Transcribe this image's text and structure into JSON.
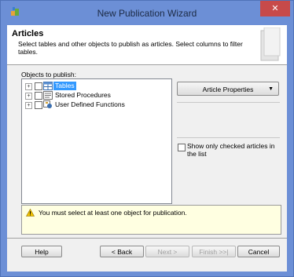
{
  "window": {
    "title": "New Publication Wizard",
    "close_glyph": "✕"
  },
  "header": {
    "title": "Articles",
    "description": "Select tables and other objects to publish as articles. Select columns to filter tables."
  },
  "objects": {
    "label": "Objects to publish:",
    "items": [
      {
        "label": "Tables",
        "selected": true,
        "icon": "table-icon"
      },
      {
        "label": "Stored Procedures",
        "selected": false,
        "icon": "stored-procedure-icon"
      },
      {
        "label": "User Defined Functions",
        "selected": false,
        "icon": "function-icon"
      }
    ],
    "expand_glyph": "+"
  },
  "article_properties": {
    "label": "Article Properties",
    "arrow": "▼"
  },
  "show_only_checked": {
    "label": "Show only checked articles in the list",
    "checked": false
  },
  "message": {
    "icon": "warning-icon",
    "text": "You must select at least one object for publication."
  },
  "buttons": {
    "help": "Help",
    "back": "< Back",
    "next": "Next >",
    "finish": "Finish >>|",
    "cancel": "Cancel"
  },
  "colors": {
    "frame": "#6c8fd6",
    "close": "#c74a4a",
    "message_bg": "#ffffe1",
    "selection": "#3399ff"
  }
}
